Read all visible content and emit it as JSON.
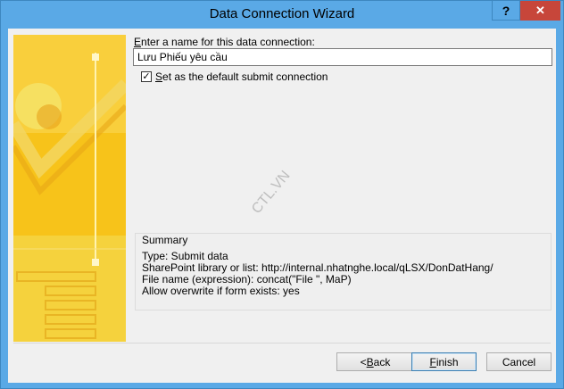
{
  "window": {
    "title": "Data Connection Wizard",
    "help_label": "?",
    "close_label": "✕"
  },
  "form": {
    "name_label_accel": "E",
    "name_label_rest": "nter a name for this data connection:",
    "name_value": "Lưu Phiếu yêu cầu",
    "default_checkbox_accel": "S",
    "default_checkbox_rest": "et as the default submit connection",
    "default_checked": true
  },
  "watermark": "CTL.VN",
  "summary": {
    "title": "Summary",
    "lines": [
      "Type: Submit data",
      "SharePoint library or list: http://internal.nhatnghe.local/qLSX/DonDatHang/",
      "File name (expression): concat(\"File \", MaP)",
      "Allow overwrite if form exists: yes"
    ]
  },
  "buttons": {
    "back_accel": "B",
    "back_prefix": "< ",
    "back_rest": "ack",
    "finish_accel": "F",
    "finish_rest": "inish",
    "cancel": "Cancel"
  },
  "colors": {
    "titlebar": "#5aa9e6",
    "close": "#c7463a",
    "art_base": "#f7c31a"
  }
}
